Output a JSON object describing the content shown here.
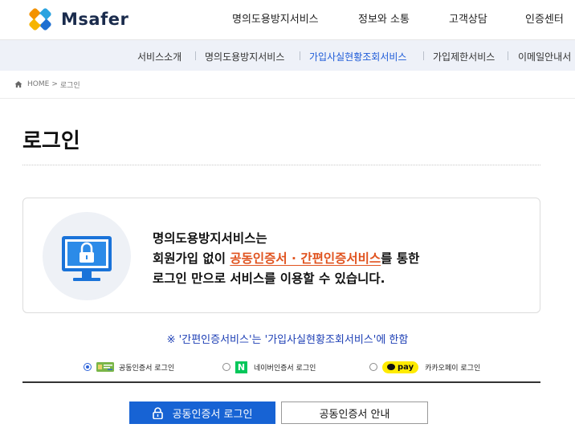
{
  "header": {
    "logo_text": "Msafer",
    "nav": [
      {
        "label": "명의도용방지서비스"
      },
      {
        "label": "정보와 소통"
      },
      {
        "label": "고객상담"
      },
      {
        "label": "인증센터"
      }
    ]
  },
  "subnav": {
    "items": [
      {
        "label": "서비스소개"
      },
      {
        "label": "명의도용방지서비스"
      },
      {
        "label": "가입사실현황조회서비스",
        "active": true
      },
      {
        "label": "가입제한서비스"
      },
      {
        "label": "이메일안내서"
      }
    ]
  },
  "breadcrumb": {
    "home": "HOME",
    "separator": ">",
    "current": "로그인"
  },
  "page": {
    "title": "로그인"
  },
  "info": {
    "line1": "명의도용방지서비스는",
    "line2_prefix": "회원가입 없이 ",
    "line2_highlight": "공동인증서 · 간편인증서비스",
    "line2_suffix": "를 통한",
    "line3": "로그인 만으로 서비스를 이용할 수 있습니다."
  },
  "notice": "※ '간편인증서비스'는 '가입사실현황조회서비스'에 한함",
  "login_options": [
    {
      "label": "공동인증서 로그인",
      "icon": "certificate-icon",
      "selected": true
    },
    {
      "label": "네이버인증서 로그인",
      "icon": "naver-icon",
      "icon_text": "N",
      "selected": false
    },
    {
      "label": "카카오페이 로그인",
      "icon": "kakaopay-icon",
      "icon_text": "pay",
      "selected": false
    }
  ],
  "buttons": {
    "primary": "공동인증서 로그인",
    "secondary": "공동인증서 안내"
  },
  "colors": {
    "brand_blue": "#1763d4",
    "notice_blue": "#1d3fb5",
    "highlight_orange": "#e0531f",
    "active_subnav": "#1e5bd8",
    "naver_green": "#03c75a",
    "kakao_yellow": "#ffeb00"
  }
}
